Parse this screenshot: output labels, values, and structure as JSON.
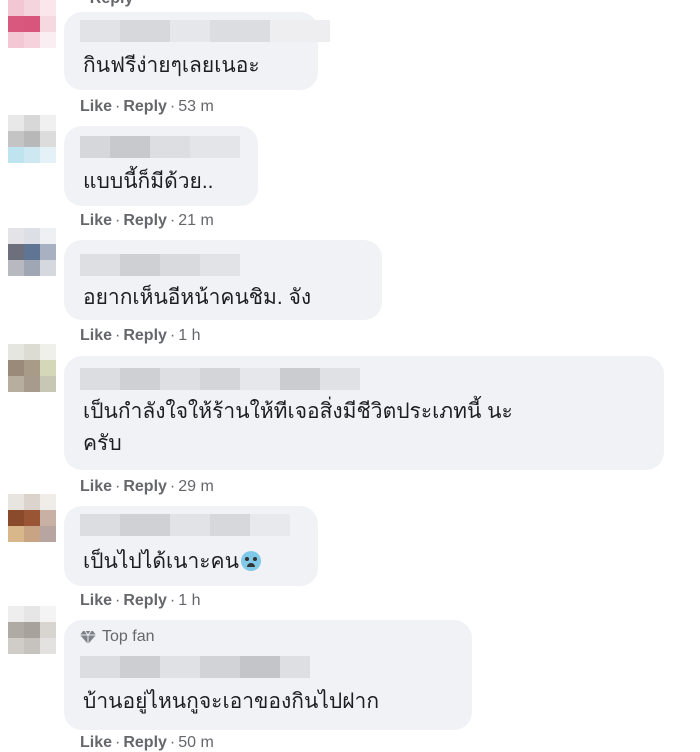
{
  "comments": [
    {
      "text": "กินฟรีง่ายๆเลยเนอะ",
      "like": "Like",
      "reply": "Reply",
      "time": "53 m"
    },
    {
      "text": "แบบนี้ก็มีด้วย..",
      "like": "Like",
      "reply": "Reply",
      "time": "21 m"
    },
    {
      "text": "อยากเห็นอีหน้าคนชิม. จัง",
      "like": "Like",
      "reply": "Reply",
      "time": "1 h"
    },
    {
      "text_line1": "เป็นกำลังใจให้ร้านให้ทีเจอสิ่งมีชีวิตประเภทนี้ นะ",
      "text_line2": "ครับ",
      "like": "Like",
      "reply": "Reply",
      "time": "29 m"
    },
    {
      "text": "เป็นไปได้เนาะคน",
      "emoji": "anxious-face-emoji",
      "like": "Like",
      "reply": "Reply",
      "time": "1 h"
    },
    {
      "badge": "Top fan",
      "badge_icon": "diamond-icon",
      "text": "บ้านอยู่ไหนกูจะเอาของกินไปฝาก",
      "like": "Like",
      "reply": "Reply",
      "time": "50 m"
    }
  ],
  "colors": {
    "bubble": "#f0f2f5",
    "meta": "#65676b",
    "text": "#1c1e21"
  }
}
